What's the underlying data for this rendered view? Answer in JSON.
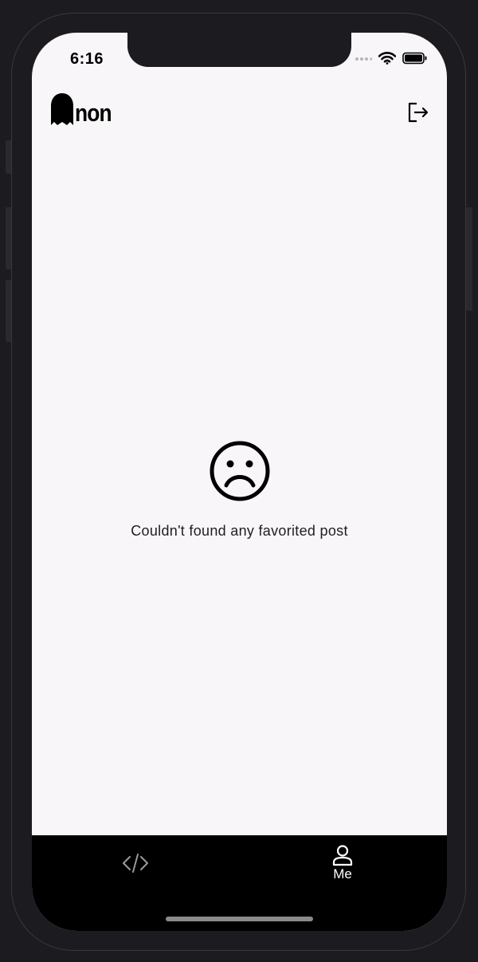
{
  "status_bar": {
    "time": "6:16"
  },
  "header": {
    "logo_text": "non",
    "logo_icon": "ghost-icon",
    "logout_icon": "logout-icon"
  },
  "empty_state": {
    "icon": "sad-face-icon",
    "message": "Couldn't found any favorited post"
  },
  "tab_bar": {
    "tabs": [
      {
        "icon": "code-icon",
        "label": "",
        "active": false
      },
      {
        "icon": "person-icon",
        "label": "Me",
        "active": true
      }
    ]
  },
  "colors": {
    "screen_background": "#f8f6f9",
    "tab_bar_background": "#000000",
    "active_tab": "#ffffff",
    "inactive_tab": "#9a9a9a"
  }
}
